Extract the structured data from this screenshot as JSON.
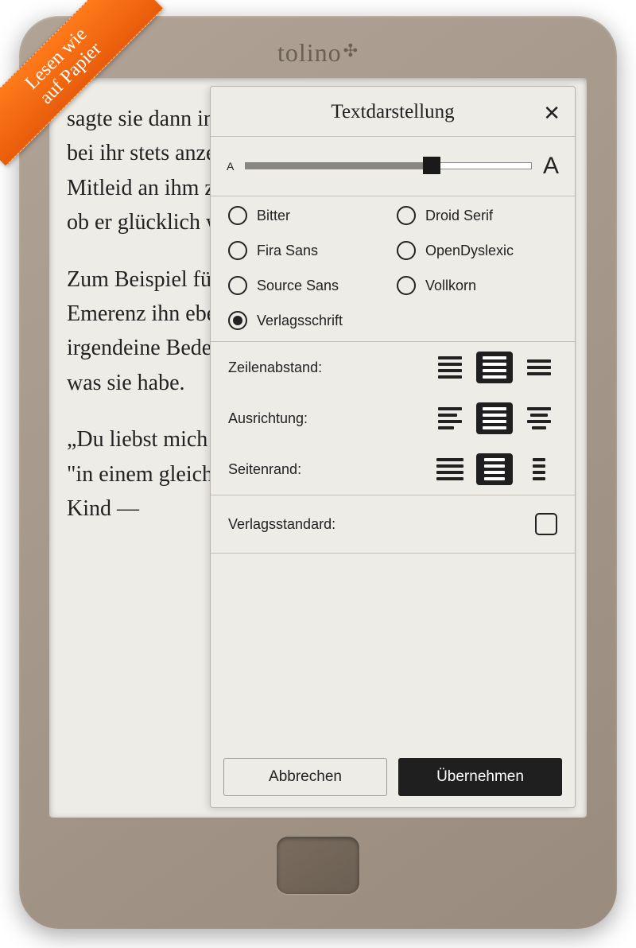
{
  "ribbon": {
    "line1": "Lesen wie",
    "line2": "auf Papier"
  },
  "brand": "tolino",
  "reader": {
    "p1": "sagte sie dann in einem sonderbar kurzes Benehmen, das bei ihr stets anzeigte, daß man an ein Geheimnis rühre, Mitleid an ihm zu üben, da er selber nicht wußte nicht, ob er glücklich war oder unter dem Gegenteil,",
    "p2": "Zum Beispiel fühlte er sich plötzlich ungehalten, als Emerenz ihn eben bat, ausgerechnet jetzt, was für irgendeine Bedeutung diese hatte. Es fragte Emerenz, was sie habe.",
    "p3": "„Du liebst mich nicht mehr\", war die Antwort an ihm, \"in einem gleichgültigem Tonen; statt zu rufen: Aber Kind —"
  },
  "panel": {
    "title": "Textdarstellung",
    "size": {
      "small": "A",
      "large": "A",
      "value": 64
    },
    "fonts": [
      "Bitter",
      "Droid Serif",
      "Fira Sans",
      "OpenDyslexic",
      "Source Sans",
      "Vollkorn",
      "Verlagsschrift"
    ],
    "selectedFont": "Verlagsschrift",
    "layout": {
      "lineSpacing": "Zeilenabstand:",
      "alignment": "Ausrichtung:",
      "margin": "Seitenrand:"
    },
    "standard": "Verlagsstandard:",
    "cancel": "Abbrechen",
    "apply": "Übernehmen"
  }
}
